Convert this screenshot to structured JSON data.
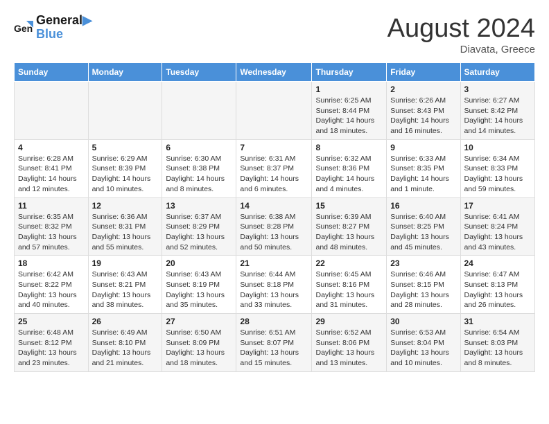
{
  "header": {
    "logo_line1": "General",
    "logo_line2": "Blue",
    "month_year": "August 2024",
    "location": "Diavata, Greece"
  },
  "days_of_week": [
    "Sunday",
    "Monday",
    "Tuesday",
    "Wednesday",
    "Thursday",
    "Friday",
    "Saturday"
  ],
  "weeks": [
    [
      {
        "day": "",
        "info": ""
      },
      {
        "day": "",
        "info": ""
      },
      {
        "day": "",
        "info": ""
      },
      {
        "day": "",
        "info": ""
      },
      {
        "day": "1",
        "info": "Sunrise: 6:25 AM\nSunset: 8:44 PM\nDaylight: 14 hours and 18 minutes."
      },
      {
        "day": "2",
        "info": "Sunrise: 6:26 AM\nSunset: 8:43 PM\nDaylight: 14 hours and 16 minutes."
      },
      {
        "day": "3",
        "info": "Sunrise: 6:27 AM\nSunset: 8:42 PM\nDaylight: 14 hours and 14 minutes."
      }
    ],
    [
      {
        "day": "4",
        "info": "Sunrise: 6:28 AM\nSunset: 8:41 PM\nDaylight: 14 hours and 12 minutes."
      },
      {
        "day": "5",
        "info": "Sunrise: 6:29 AM\nSunset: 8:39 PM\nDaylight: 14 hours and 10 minutes."
      },
      {
        "day": "6",
        "info": "Sunrise: 6:30 AM\nSunset: 8:38 PM\nDaylight: 14 hours and 8 minutes."
      },
      {
        "day": "7",
        "info": "Sunrise: 6:31 AM\nSunset: 8:37 PM\nDaylight: 14 hours and 6 minutes."
      },
      {
        "day": "8",
        "info": "Sunrise: 6:32 AM\nSunset: 8:36 PM\nDaylight: 14 hours and 4 minutes."
      },
      {
        "day": "9",
        "info": "Sunrise: 6:33 AM\nSunset: 8:35 PM\nDaylight: 14 hours and 1 minute."
      },
      {
        "day": "10",
        "info": "Sunrise: 6:34 AM\nSunset: 8:33 PM\nDaylight: 13 hours and 59 minutes."
      }
    ],
    [
      {
        "day": "11",
        "info": "Sunrise: 6:35 AM\nSunset: 8:32 PM\nDaylight: 13 hours and 57 minutes."
      },
      {
        "day": "12",
        "info": "Sunrise: 6:36 AM\nSunset: 8:31 PM\nDaylight: 13 hours and 55 minutes."
      },
      {
        "day": "13",
        "info": "Sunrise: 6:37 AM\nSunset: 8:29 PM\nDaylight: 13 hours and 52 minutes."
      },
      {
        "day": "14",
        "info": "Sunrise: 6:38 AM\nSunset: 8:28 PM\nDaylight: 13 hours and 50 minutes."
      },
      {
        "day": "15",
        "info": "Sunrise: 6:39 AM\nSunset: 8:27 PM\nDaylight: 13 hours and 48 minutes."
      },
      {
        "day": "16",
        "info": "Sunrise: 6:40 AM\nSunset: 8:25 PM\nDaylight: 13 hours and 45 minutes."
      },
      {
        "day": "17",
        "info": "Sunrise: 6:41 AM\nSunset: 8:24 PM\nDaylight: 13 hours and 43 minutes."
      }
    ],
    [
      {
        "day": "18",
        "info": "Sunrise: 6:42 AM\nSunset: 8:22 PM\nDaylight: 13 hours and 40 minutes."
      },
      {
        "day": "19",
        "info": "Sunrise: 6:43 AM\nSunset: 8:21 PM\nDaylight: 13 hours and 38 minutes."
      },
      {
        "day": "20",
        "info": "Sunrise: 6:43 AM\nSunset: 8:19 PM\nDaylight: 13 hours and 35 minutes."
      },
      {
        "day": "21",
        "info": "Sunrise: 6:44 AM\nSunset: 8:18 PM\nDaylight: 13 hours and 33 minutes."
      },
      {
        "day": "22",
        "info": "Sunrise: 6:45 AM\nSunset: 8:16 PM\nDaylight: 13 hours and 31 minutes."
      },
      {
        "day": "23",
        "info": "Sunrise: 6:46 AM\nSunset: 8:15 PM\nDaylight: 13 hours and 28 minutes."
      },
      {
        "day": "24",
        "info": "Sunrise: 6:47 AM\nSunset: 8:13 PM\nDaylight: 13 hours and 26 minutes."
      }
    ],
    [
      {
        "day": "25",
        "info": "Sunrise: 6:48 AM\nSunset: 8:12 PM\nDaylight: 13 hours and 23 minutes."
      },
      {
        "day": "26",
        "info": "Sunrise: 6:49 AM\nSunset: 8:10 PM\nDaylight: 13 hours and 21 minutes."
      },
      {
        "day": "27",
        "info": "Sunrise: 6:50 AM\nSunset: 8:09 PM\nDaylight: 13 hours and 18 minutes."
      },
      {
        "day": "28",
        "info": "Sunrise: 6:51 AM\nSunset: 8:07 PM\nDaylight: 13 hours and 15 minutes."
      },
      {
        "day": "29",
        "info": "Sunrise: 6:52 AM\nSunset: 8:06 PM\nDaylight: 13 hours and 13 minutes."
      },
      {
        "day": "30",
        "info": "Sunrise: 6:53 AM\nSunset: 8:04 PM\nDaylight: 13 hours and 10 minutes."
      },
      {
        "day": "31",
        "info": "Sunrise: 6:54 AM\nSunset: 8:03 PM\nDaylight: 13 hours and 8 minutes."
      }
    ]
  ]
}
